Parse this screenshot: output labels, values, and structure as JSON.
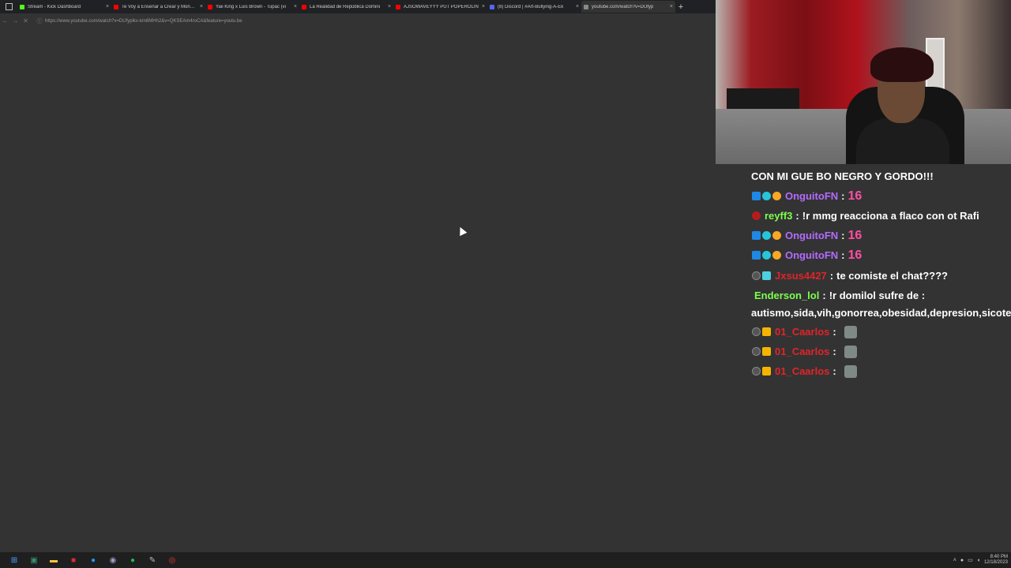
{
  "browser": {
    "tabs": [
      {
        "title": "Stream - Kick Dashboard",
        "favicon_color": "#53fc18"
      },
      {
        "title": "Te Voy a Enseñar a Crear y Monetiz",
        "favicon_color": "#ff0000"
      },
      {
        "title": "Yaii King x Luis Brown - Tupac (vi",
        "favicon_color": "#ff0000"
      },
      {
        "title": "La Realidad de República Domini",
        "favicon_color": "#ff0000"
      },
      {
        "title": "AJSOWAVEYYY PUT POPEROLIN",
        "favicon_color": "#ff0000"
      },
      {
        "title": "(8) Discord | #Art-Bullying-A-Ek",
        "favicon_color": "#5865f2"
      },
      {
        "title": "youtube.com/watch?v=DUfyp",
        "favicon_color": "#888888",
        "active": true
      }
    ],
    "new_tab_label": "+",
    "url": "https://www.youtube.com/watch?v=DUfyplkx-km8MHh2&v=QKSEAm4roCA&feature=youtu.be"
  },
  "chat": {
    "messages": [
      {
        "user": "",
        "text": "CON MI GUE BO NEGRO Y GORDO!!!",
        "user_color": "#ffffff",
        "badges": []
      },
      {
        "user": "OnguitoFN",
        "text": "16",
        "user_color": "#b36bff",
        "badges": [
          "blue",
          "cyan",
          "gold"
        ],
        "is_number": true
      },
      {
        "user": "reyff3",
        "text": "!r mmg reacciona a flaco con ot Rafi",
        "user_color": "#7cff4f",
        "badges": [
          "red"
        ]
      },
      {
        "user": "OnguitoFN",
        "text": "16",
        "user_color": "#b36bff",
        "badges": [
          "blue",
          "cyan",
          "gold"
        ],
        "is_number": true
      },
      {
        "user": "OnguitoFN",
        "text": "16",
        "user_color": "#b36bff",
        "badges": [
          "blue",
          "cyan",
          "gold"
        ],
        "is_number": true
      },
      {
        "user": "Jxsus4427",
        "text": "te comiste el chat????",
        "user_color": "#e0242a",
        "badges": [
          "dark",
          "grid"
        ]
      },
      {
        "user": "Enderson_lol",
        "text": "!r domilol sufre de :",
        "user_color": "#7cff4f",
        "badges": []
      },
      {
        "user": "",
        "text": "autismo,sida,vih,gonorrea,obesidad,depresion,sicote,",
        "user_color": "#ffffff",
        "badges": []
      },
      {
        "user": "01_Caarlos",
        "text": "",
        "user_color": "#e0242a",
        "badges": [
          "dark",
          "crown"
        ],
        "emote": true
      },
      {
        "user": "01_Caarlos",
        "text": "",
        "user_color": "#e0242a",
        "badges": [
          "dark",
          "crown"
        ],
        "emote": true
      },
      {
        "user": "01_Caarlos",
        "text": "",
        "user_color": "#e0242a",
        "badges": [
          "dark",
          "crown"
        ],
        "emote": true
      }
    ],
    "separator": ":"
  },
  "taskbar": {
    "icons": [
      "windows-start",
      "terminal",
      "file-explorer",
      "app-red",
      "edge",
      "obs",
      "spotify",
      "app-pen",
      "chrome"
    ],
    "time": "8:40 PM",
    "date": "12/18/2023"
  }
}
